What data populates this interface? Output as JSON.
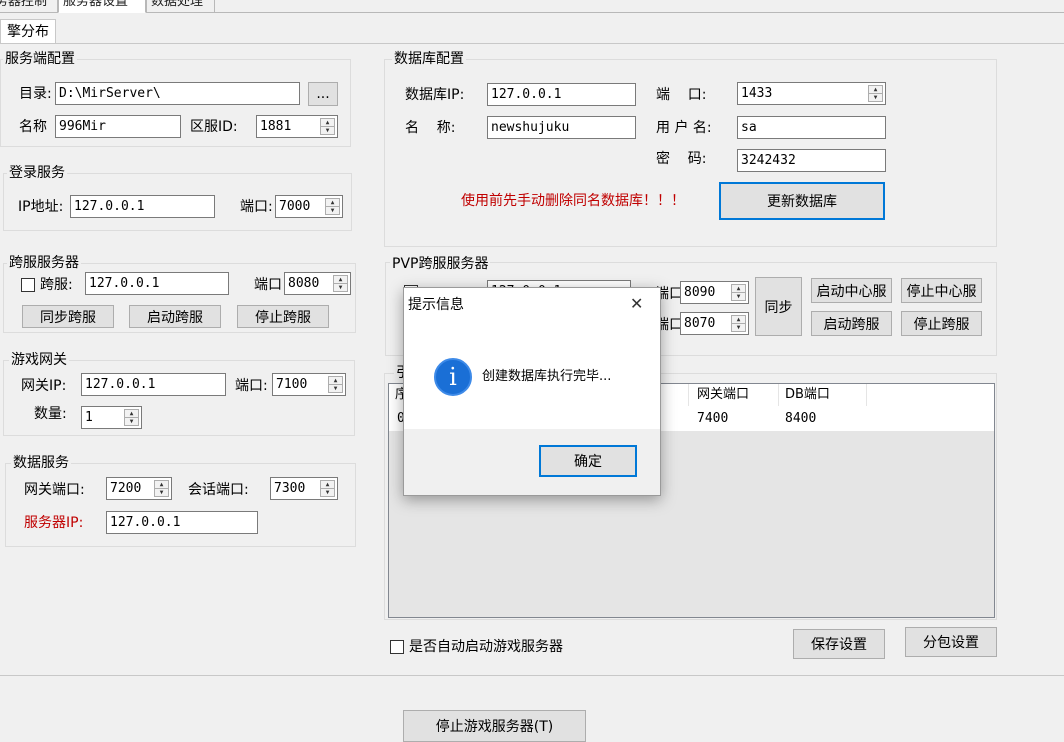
{
  "tabs": [
    "务器控制",
    "服务器设置",
    "数据处理"
  ],
  "subtab": "擎分布",
  "server_config": {
    "title": "服务端配置",
    "dir_label": "目录:",
    "dir_value": "D:\\MirServer\\",
    "browse_label": "...",
    "name_label": "名称",
    "name_value": "996Mir",
    "zone_label": "区服ID:",
    "zone_value": "1881"
  },
  "db_config": {
    "title": "数据库配置",
    "ip_label": "数据库IP:",
    "ip_value": "127.0.0.1",
    "port_label": "端    口:",
    "port_value": "1433",
    "name_label": "名    称:",
    "name_value": "newshujuku",
    "user_label": "用 户 名:",
    "user_value": "sa",
    "pwd_label": "密    码:",
    "pwd_value": "3242432",
    "warning": "使用前先手动删除同名数据库！！！",
    "update_button": "更新数据库"
  },
  "login_service": {
    "title": "登录服务",
    "ip_label": "IP地址:",
    "ip_value": "127.0.0.1",
    "port_label": "端口:",
    "port_value": "7000"
  },
  "cross_server": {
    "title": "跨服服务器",
    "check_label": "跨服:",
    "ip_value": "127.0.0.1",
    "port_label": "端口",
    "port_value": "8080",
    "sync_button": "同步跨服",
    "start_button": "启动跨服",
    "stop_button": "停止跨服"
  },
  "pvp_server": {
    "title": "PVP跨服服务器",
    "ip_partial": "127.0.0.1",
    "port1_label": "端口",
    "port1_value": "8090",
    "port2_label": "端口",
    "port2_value": "8070",
    "sync_button": "同步",
    "start_center": "启动中心服",
    "stop_center": "停止中心服",
    "start_cross": "启动跨服",
    "stop_cross": "停止跨服"
  },
  "game_gateway": {
    "title": "游戏网关",
    "ip_label": "网关IP:",
    "ip_value": "127.0.0.1",
    "port_label": "端口:",
    "port_value": "7100",
    "count_label": "数量:",
    "count_value": "1"
  },
  "data_service": {
    "title": "数据服务",
    "gw_port_label": "网关端口:",
    "gw_port_value": "7200",
    "session_port_label": "会话端口:",
    "session_port_value": "7300",
    "server_ip_label": "服务器IP:",
    "server_ip_value": "127.0.0.1"
  },
  "engine_list": {
    "title_partial": "引",
    "col_first_partial": "序",
    "col_gw_port": "网关端口",
    "col_db_port": "DB端口",
    "row_first_partial": "0",
    "row_gw_port": "7400",
    "row_db_port": "8400"
  },
  "autostart_label": "是否自动启动游戏服务器",
  "save_button": "保存设置",
  "split_button": "分包设置",
  "stop_game_button": "停止游戏服务器(T)",
  "dialog": {
    "title": "提示信息",
    "close_glyph": "✕",
    "icon": "info-icon",
    "message": "创建数据库执行完毕...",
    "ok_button": "确定"
  },
  "colors": {
    "warning_red": "#c00000",
    "info_blue": "#1a6fd6",
    "focus_blue": "#0078d7"
  }
}
